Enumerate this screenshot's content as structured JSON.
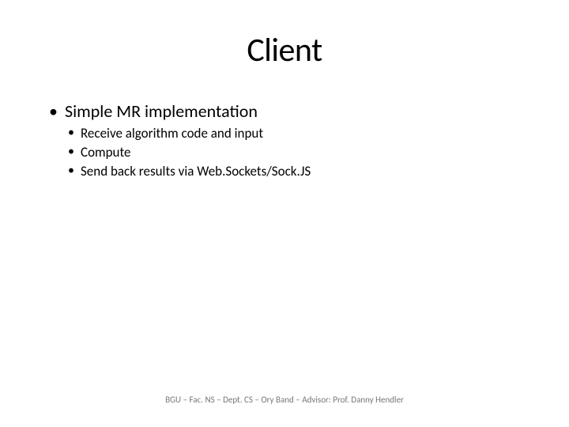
{
  "slide": {
    "title": "Client",
    "bullets": {
      "main": "Simple MR implementation",
      "sub1": "Receive algorithm code and input",
      "sub2": "Compute",
      "sub3": "Send back results via Web.Sockets/Sock.JS"
    },
    "footer": "BGU – Fac. NS – Dept. CS – Ory Band – Advisor: Prof. Danny Hendler"
  }
}
